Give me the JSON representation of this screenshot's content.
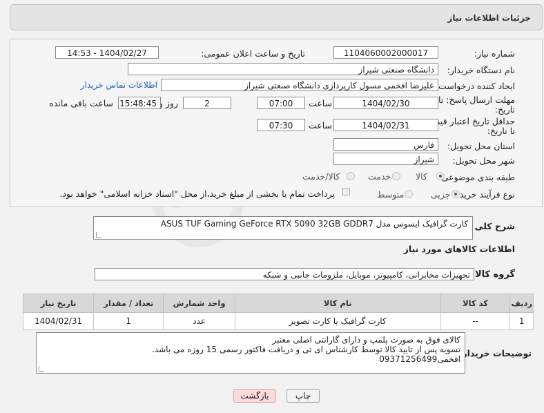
{
  "header": {
    "title": "جزئیات اطلاعات نیاز"
  },
  "form": {
    "need_number_label": "شماره نیاز:",
    "need_number": "1104060002000017",
    "announce_label": "تاریخ و ساعت اعلان عمومی:",
    "announce_value": "1404/02/27 - 14:53",
    "buyer_org_label": "نام دستگاه خریدار:",
    "buyer_org": "دانشگاه صنعتی شیراز",
    "requester_label": "ایجاد کننده درخواست:",
    "requester": "علیرضا افخمی مسول کارپردازی دانشگاه صنعتی شیراز",
    "contact_link": "اطلاعات تماس خریدار",
    "deadline_label_1": "مهلت ارسال پاسخ: تا",
    "deadline_label_2": "تاریخ:",
    "deadline_date": "1404/02/30",
    "time_label": "ساعت",
    "deadline_time": "07:00",
    "days_value": "2",
    "days_label": "روز و",
    "remaining_time": "15:48:45",
    "remaining_label": "ساعت باقی مانده",
    "validity_label_1": "حداقل تاریخ اعتبار قیمت:",
    "validity_label_2": "تا تاریخ:",
    "validity_date": "1404/02/31",
    "validity_time_label": "ساعت",
    "validity_time": "07:30",
    "province_label": "استان محل تحویل:",
    "province": "فارس",
    "city_label": "شهر محل تحویل:",
    "city": "شیراز",
    "category_label": "طبقه بندی موضوعی:",
    "category_options": [
      "کالا",
      "خدمت",
      "کالا/خدمت"
    ],
    "category_selected": "کالا",
    "purchase_type_label": "نوع فرآیند خرید :",
    "purchase_options": [
      "جزیی",
      "متوسط"
    ],
    "purchase_note": "پرداخت تمام یا بخشی از مبلغ خرید،از محل \"اسناد خزانه اسلامی\" خواهد بود."
  },
  "description": {
    "label": "شرح کلی نیاز:",
    "value": "کارت گرافیک ایسوس مدل ASUS TUF Gaming GeForce RTX 5090 32GB GDDR7"
  },
  "goods_info": {
    "title": "اطلاعات کالاهای مورد نیاز",
    "group_label": "گروه کالا:",
    "group_value": "تجهیزات مخابراتی، کامپیوتر، موبایل، ملزومات جانبی و شبکه"
  },
  "table": {
    "headers": [
      "ردیف",
      "کد کالا",
      "نام کالا",
      "واحد شمارش",
      "تعداد / مقدار",
      "تاریخ نیاز"
    ],
    "rows": [
      [
        "1",
        "--",
        "کارت گرافیک یا کارت تصویر",
        "عدد",
        "1",
        "1404/02/31"
      ]
    ]
  },
  "buyer_notes": {
    "label": "توضیحات خریدار:",
    "lines": [
      "کالای فوق به صورت پلمپ و دارای گارانتی اصلی معتبر",
      "تسویه پس از تایید کالا توسط کارشناس ای تی و دریافت فاکتور رسمی 15 روزه می باشد.",
      "افخمی09371256499"
    ]
  },
  "buttons": {
    "print": "چاپ",
    "back": "بازگشت"
  },
  "watermark": {
    "text": "AriaTender.net"
  }
}
